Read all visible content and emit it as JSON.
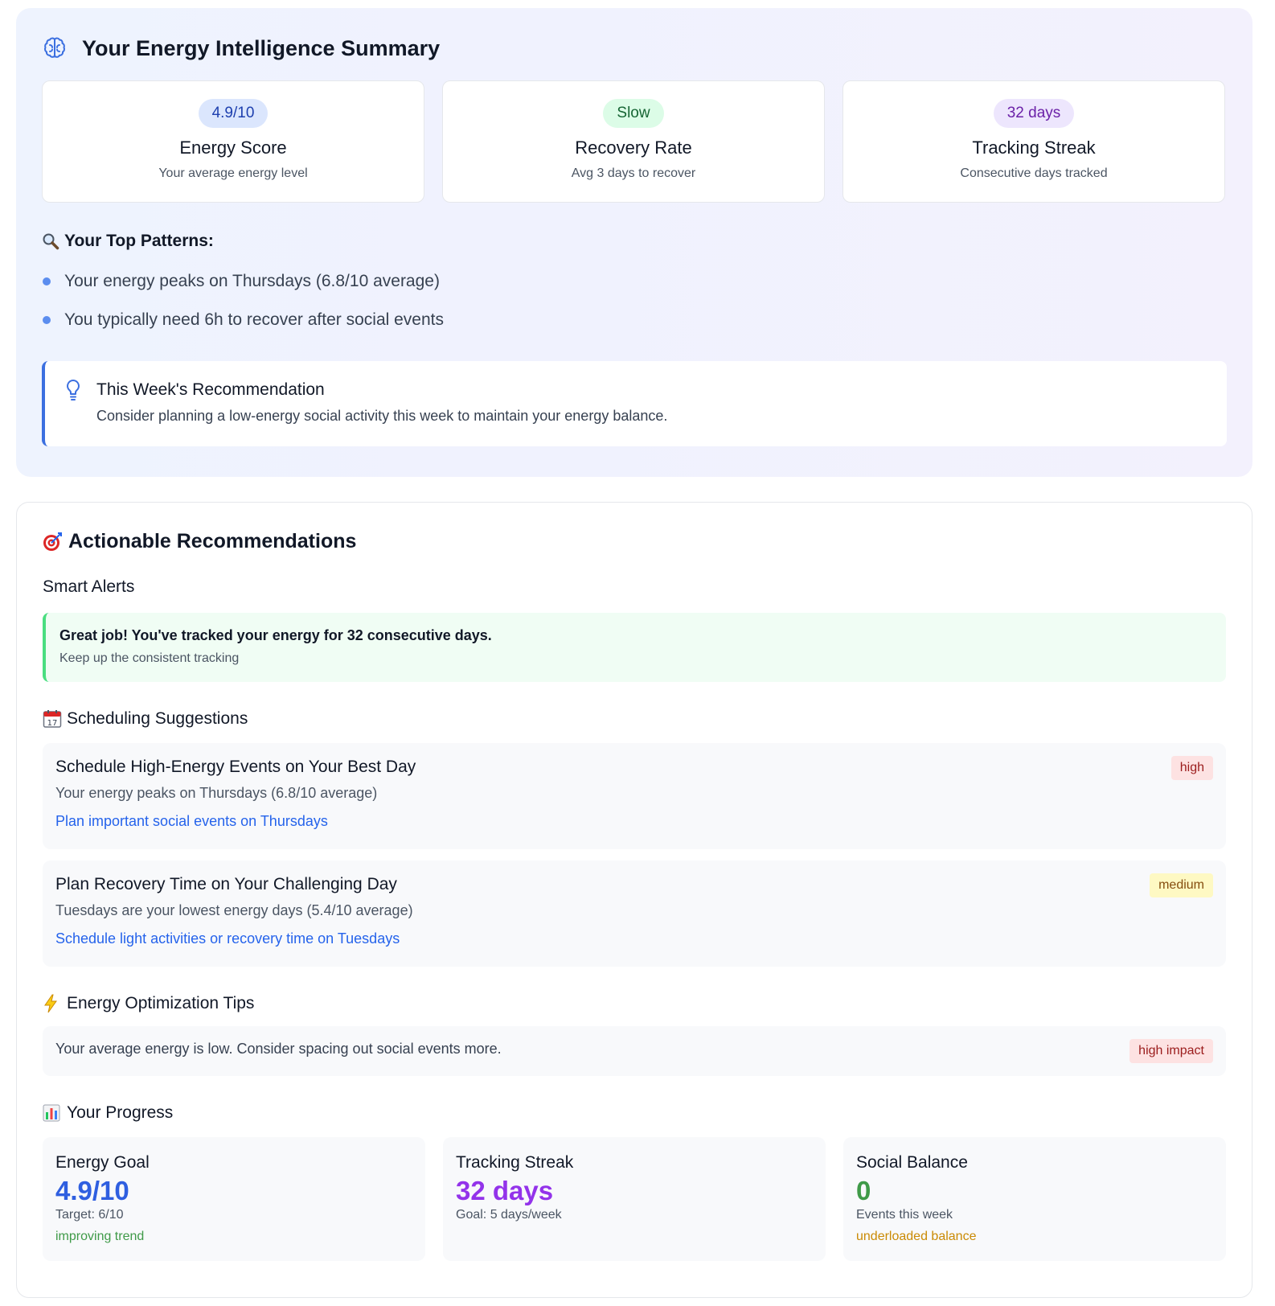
{
  "summary": {
    "title": "Your Energy Intelligence Summary",
    "metrics": [
      {
        "pill": "4.9/10",
        "label": "Energy Score",
        "sub": "Your average energy level"
      },
      {
        "pill": "Slow",
        "label": "Recovery Rate",
        "sub": "Avg 3 days to recover"
      },
      {
        "pill": "32 days",
        "label": "Tracking Streak",
        "sub": "Consecutive days tracked"
      }
    ],
    "patterns_title": "Your Top Patterns:",
    "patterns": [
      "Your energy peaks on Thursdays (6.8/10 average)",
      "You typically need 6h to recover after social events"
    ],
    "recommendation": {
      "title": "This Week's Recommendation",
      "text": "Consider planning a low-energy social activity this week to maintain your energy balance."
    }
  },
  "actions": {
    "title": "Actionable Recommendations",
    "smart_alerts_title": "Smart Alerts",
    "alert": {
      "title": "Great job! You've tracked your energy for 32 consecutive days.",
      "sub": "Keep up the consistent tracking"
    },
    "scheduling_title": "Scheduling Suggestions",
    "suggestions": [
      {
        "title": "Schedule High-Energy Events on Your Best Day",
        "desc": "Your energy peaks on Thursdays (6.8/10 average)",
        "action": "Plan important social events on Thursdays",
        "badge": "high"
      },
      {
        "title": "Plan Recovery Time on Your Challenging Day",
        "desc": "Tuesdays are your lowest energy days (5.4/10 average)",
        "action": "Schedule light activities or recovery time on Tuesdays",
        "badge": "medium"
      }
    ],
    "tips_title": "Energy Optimization Tips",
    "tip": {
      "text": "Your average energy is low. Consider spacing out social events more.",
      "badge": "high impact"
    },
    "progress_title": "Your Progress",
    "progress": [
      {
        "label": "Energy Goal",
        "value": "4.9/10",
        "sub": "Target: 6/10",
        "trend": "improving trend"
      },
      {
        "label": "Tracking Streak",
        "value": "32 days",
        "sub": "Goal: 5 days/week",
        "trend": ""
      },
      {
        "label": "Social Balance",
        "value": "0",
        "sub": "Events this week",
        "trend": "underloaded balance"
      }
    ]
  },
  "colors": {
    "accent_blue": "#2f5fe0",
    "accent_purple": "#9333ea",
    "accent_green": "#3f9a48",
    "badge_high": "#fde2e2",
    "badge_medium": "#fef9c3"
  },
  "icons": [
    "brain-icon",
    "magnifier-icon",
    "lightbulb-icon",
    "target-icon",
    "calendar-icon",
    "lightning-icon",
    "bar-chart-icon"
  ]
}
